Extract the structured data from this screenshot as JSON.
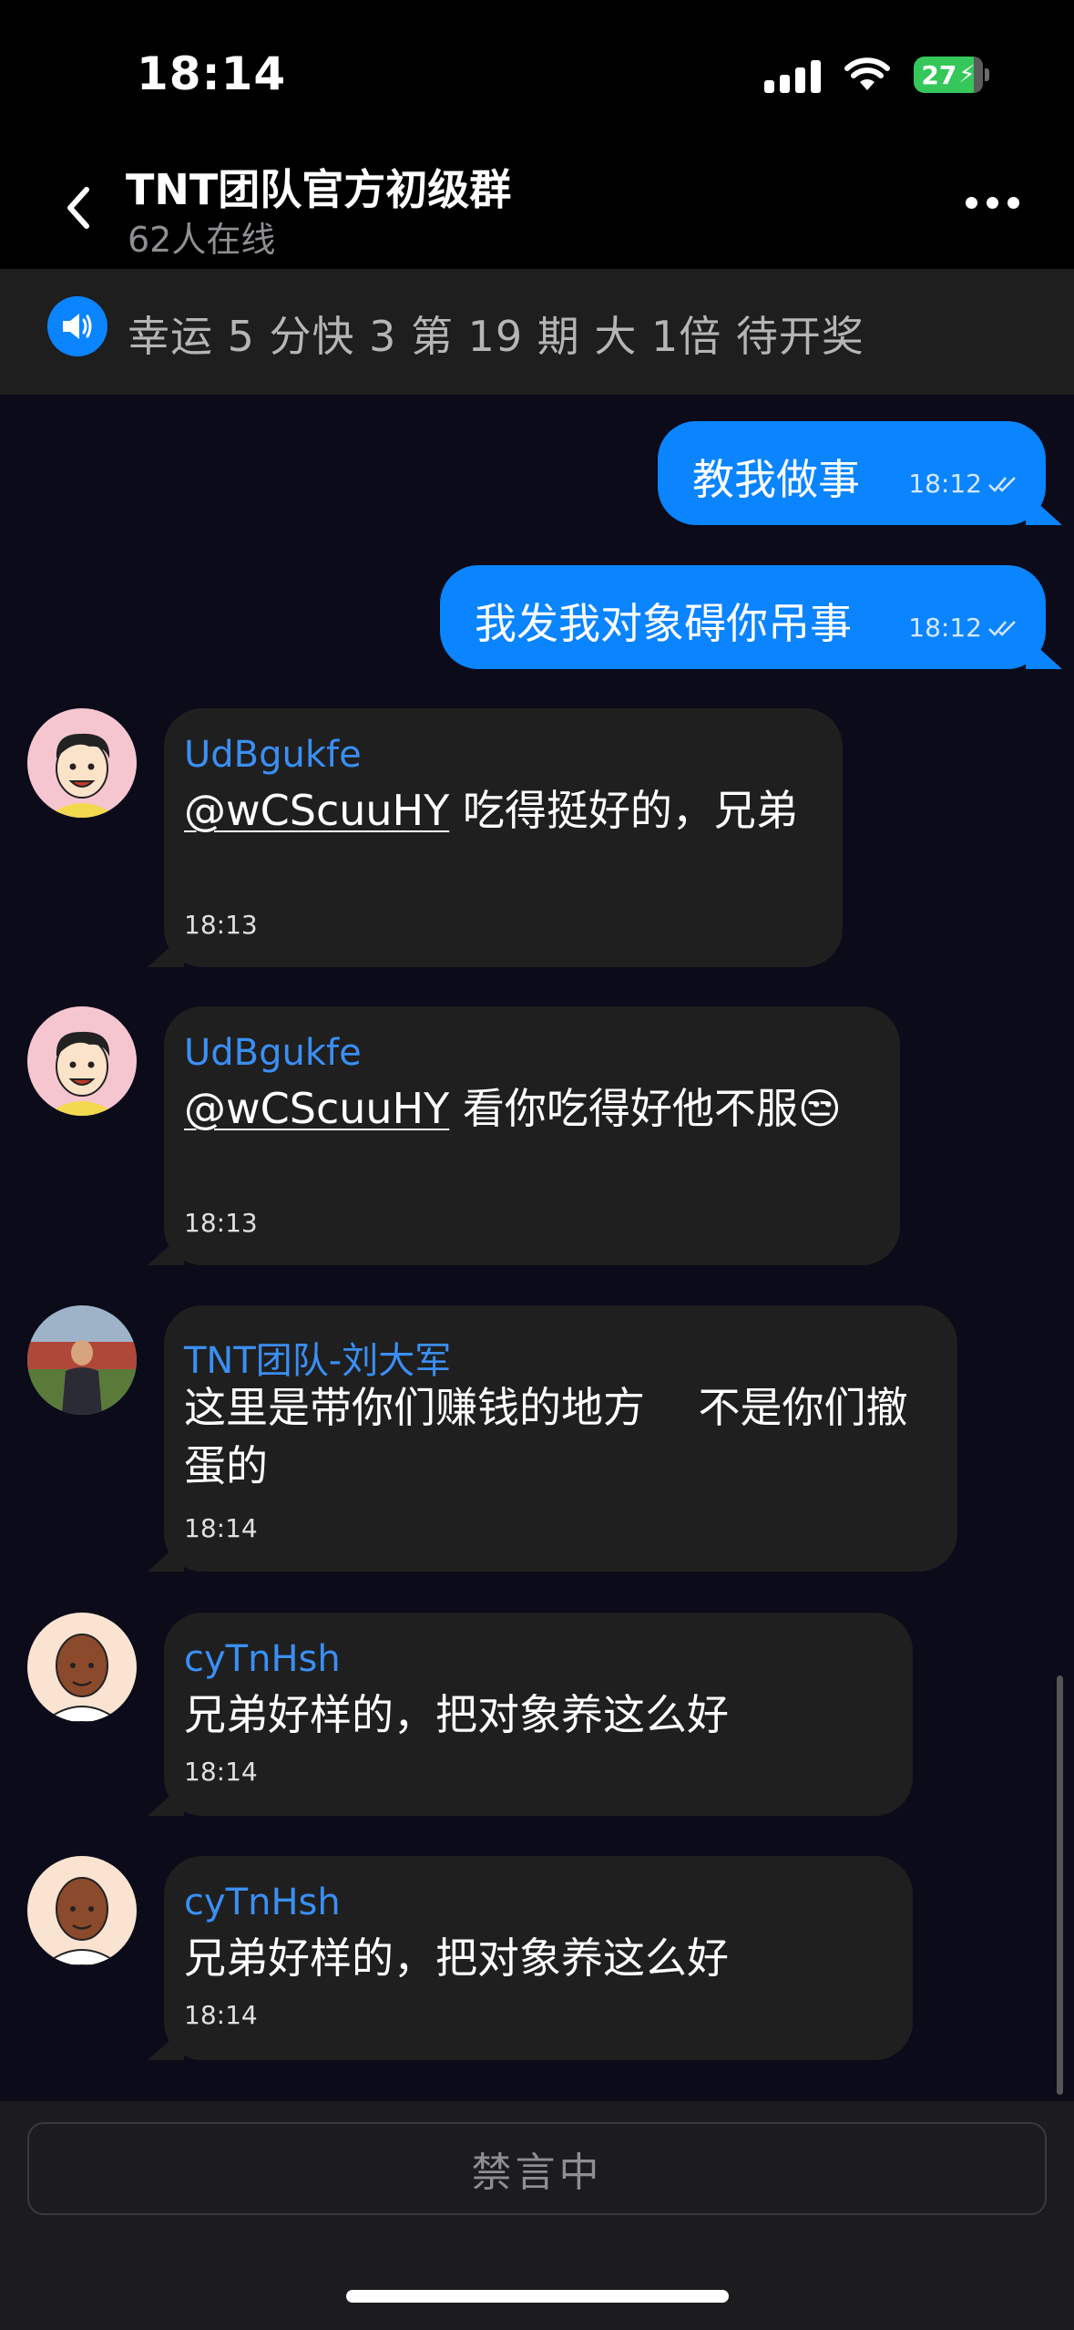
{
  "status_bar": {
    "time": "18:14",
    "battery": "27"
  },
  "header": {
    "title": "TNT团队官方初级群",
    "subtitle": "62人在线"
  },
  "announcement": {
    "text": "幸运 5 分快 3 第 19 期 大 1倍 待开奖"
  },
  "messages": [
    {
      "direction": "out",
      "text": "教我做事",
      "time": "18:12"
    },
    {
      "direction": "out",
      "text": "我发我对象碍你吊事",
      "time": "18:12"
    },
    {
      "direction": "in",
      "sender": "UdBgukfe",
      "mention": "@wCScuuHY",
      "text": " 吃得挺好的，兄弟",
      "time": "18:13",
      "avatar": "cartoon-man-icon"
    },
    {
      "direction": "in",
      "sender": "UdBgukfe",
      "mention": "@wCScuuHY",
      "text": " 看你吃得好他不服😒",
      "time": "18:13",
      "avatar": "cartoon-man-icon"
    },
    {
      "direction": "in",
      "sender": "TNT团队-刘大军",
      "text_line1": "这里是带你们赚钱的地方    不是你们撤",
      "text_line2": "蛋的",
      "time": "18:14",
      "avatar": "photo-avatar"
    },
    {
      "direction": "in",
      "sender": "cyTnHsh",
      "text": "兄弟好样的，把对象养这么好",
      "time": "18:14",
      "avatar": "cartoon-bald-man-icon"
    },
    {
      "direction": "in",
      "sender": "cyTnHsh",
      "text": "兄弟好样的，把对象养这么好",
      "time": "18:14",
      "avatar": "cartoon-bald-man-icon"
    }
  ],
  "input": {
    "muted_text": "禁言中"
  },
  "colors": {
    "accent": "#0a84ff",
    "sender_name": "#3a8ff5",
    "background": "#0b0b19",
    "bubble_in": "#1f1f1f"
  }
}
